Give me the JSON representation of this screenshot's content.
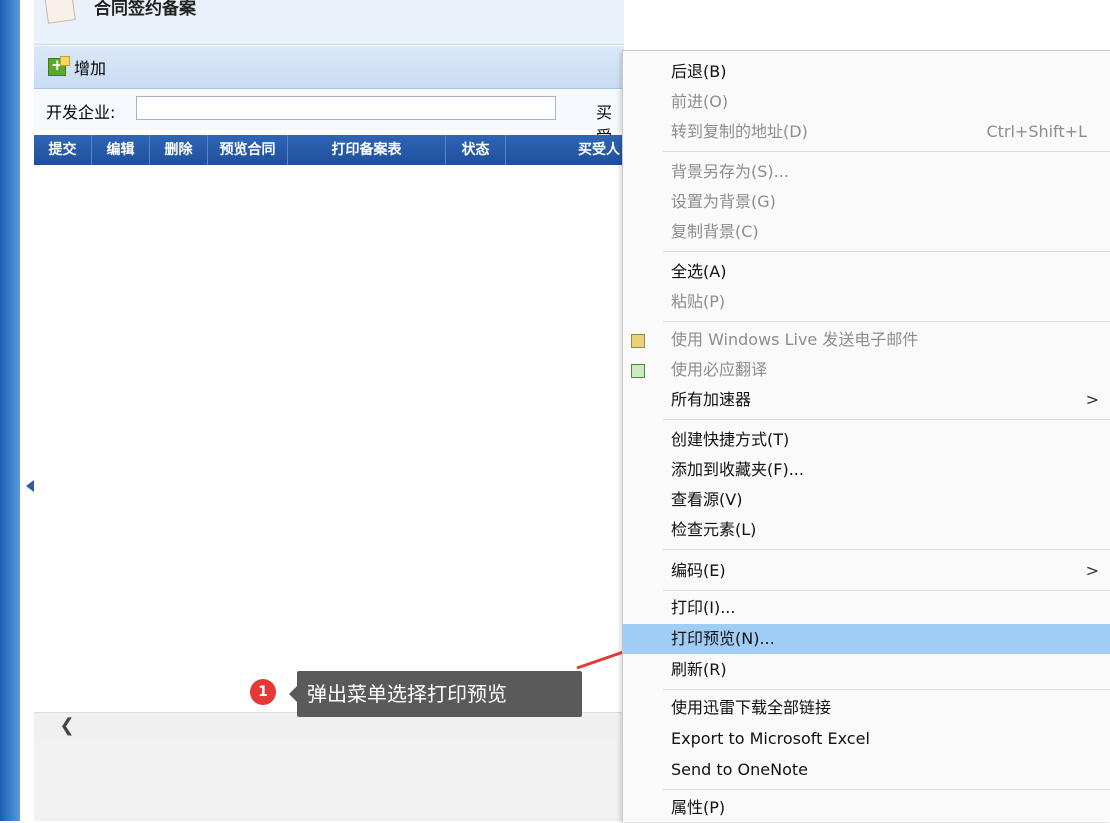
{
  "window": {
    "title": "合同签约备案"
  },
  "toolbar": {
    "add_label": "增加"
  },
  "filter": {
    "company_label": "开发企业:",
    "company_value": "",
    "buyer_label": "买受"
  },
  "grid": {
    "columns": [
      "提交",
      "编辑",
      "删除",
      "预览合同",
      "打印备案表",
      "状态",
      "买受人"
    ]
  },
  "annotation": {
    "badge": "1",
    "text": "弹出菜单选择打印预览"
  },
  "context_menu": {
    "items": [
      {
        "label": "后退(B)",
        "shortcut": "",
        "disabled": false,
        "submenu": false
      },
      {
        "label": "前进(O)",
        "shortcut": "",
        "disabled": true,
        "submenu": false
      },
      {
        "label": "转到复制的地址(D)",
        "shortcut": "Ctrl+Shift+L",
        "disabled": true,
        "submenu": false
      },
      {
        "label": "背景另存为(S)...",
        "shortcut": "",
        "disabled": true,
        "submenu": false
      },
      {
        "label": "设置为背景(G)",
        "shortcut": "",
        "disabled": true,
        "submenu": false
      },
      {
        "label": "复制背景(C)",
        "shortcut": "",
        "disabled": true,
        "submenu": false
      },
      {
        "label": "全选(A)",
        "shortcut": "",
        "disabled": false,
        "submenu": false
      },
      {
        "label": "粘贴(P)",
        "shortcut": "",
        "disabled": true,
        "submenu": false
      },
      {
        "label": "使用 Windows Live 发送电子邮件",
        "shortcut": "",
        "disabled": true,
        "submenu": false,
        "icon": "windows-live-mail-icon"
      },
      {
        "label": "使用必应翻译",
        "shortcut": "",
        "disabled": true,
        "submenu": false,
        "icon": "bing-translate-icon"
      },
      {
        "label": "所有加速器",
        "shortcut": "",
        "disabled": false,
        "submenu": true,
        "chevron": ">"
      },
      {
        "label": "创建快捷方式(T)",
        "shortcut": "",
        "disabled": false,
        "submenu": false
      },
      {
        "label": "添加到收藏夹(F)...",
        "shortcut": "",
        "disabled": false,
        "submenu": false
      },
      {
        "label": "查看源(V)",
        "shortcut": "",
        "disabled": false,
        "submenu": false
      },
      {
        "label": "检查元素(L)",
        "shortcut": "",
        "disabled": false,
        "submenu": false
      },
      {
        "label": "编码(E)",
        "shortcut": "",
        "disabled": false,
        "submenu": true,
        "chevron": ">"
      },
      {
        "label": "打印(I)...",
        "shortcut": "",
        "disabled": false,
        "submenu": false
      },
      {
        "label": "打印预览(N)...",
        "shortcut": "",
        "disabled": false,
        "submenu": false,
        "highlighted": true
      },
      {
        "label": "刷新(R)",
        "shortcut": "",
        "disabled": false,
        "submenu": false
      },
      {
        "label": "使用迅雷下载全部链接",
        "shortcut": "",
        "disabled": false,
        "submenu": false
      },
      {
        "label": "Export to Microsoft Excel",
        "shortcut": "",
        "disabled": false,
        "submenu": false
      },
      {
        "label": "Send to OneNote",
        "shortcut": "",
        "disabled": false,
        "submenu": false
      },
      {
        "label": "属性(P)",
        "shortcut": "",
        "disabled": false,
        "submenu": false
      }
    ]
  },
  "colors": {
    "highlight": "#9fcdf6",
    "header": "#2456a6",
    "annotation_red": "#e53935",
    "tooltip_bg": "#5a5a5a"
  }
}
